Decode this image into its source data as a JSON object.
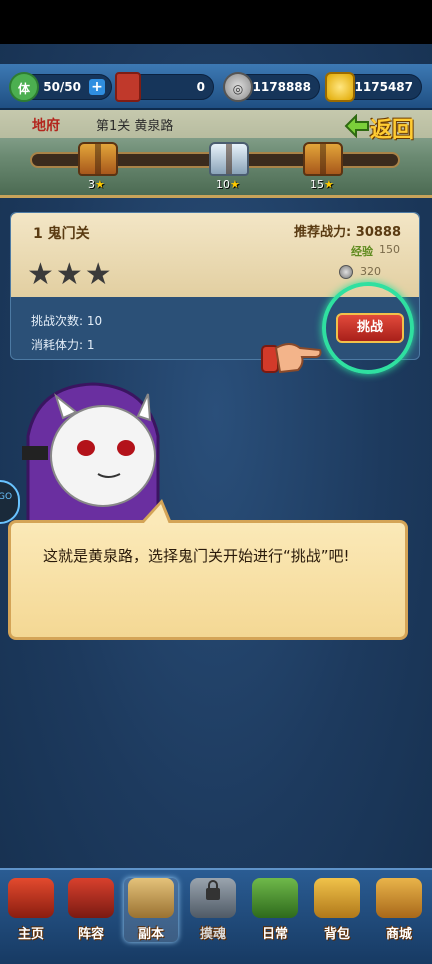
{
  "resources": {
    "stamina": {
      "icon": "stamina-icon",
      "icon_text": "体",
      "value": "50/50",
      "add": "+"
    },
    "tickets": {
      "icon": "ticket-icon",
      "value": "0"
    },
    "silver": {
      "icon": "silver-coin-icon",
      "value": "1178888"
    },
    "gold": {
      "icon": "gold-ingot-icon",
      "value": "1175487"
    }
  },
  "header": {
    "map_name": "地府",
    "stage_title": "第1关 黄泉路",
    "back_label": "返回",
    "chests": [
      {
        "stars": "3",
        "kind": "gold"
      },
      {
        "stars": "10",
        "kind": "silver"
      },
      {
        "stars": "15",
        "kind": "gold"
      }
    ],
    "star_glyph": "★"
  },
  "stage": {
    "name": "1 鬼门关",
    "recommended_power": "推荐战力: 30888",
    "exp_label": "经验",
    "exp_value": "150",
    "coin_value": "320",
    "stars": "★★★",
    "attempts": "挑战次数: 10",
    "stamina_cost": "消耗体力: 1",
    "challenge_button": "挑战"
  },
  "dialog": {
    "text": "这就是黄泉路，选择鬼门关开始进行“挑战”吧!"
  },
  "nav": [
    {
      "label": "主页",
      "icon": "home-icon"
    },
    {
      "label": "阵容",
      "icon": "lineup-flag-icon"
    },
    {
      "label": "副本",
      "icon": "dungeon-swords-icon",
      "active": true
    },
    {
      "label": "摸魂",
      "icon": "lock-icon",
      "locked": true
    },
    {
      "label": "日常",
      "icon": "daily-scroll-icon"
    },
    {
      "label": "背包",
      "icon": "bag-icon"
    },
    {
      "label": "商城",
      "icon": "shop-icon"
    }
  ],
  "colors": {
    "accent_red": "#b3261e",
    "challenge_ring": "#2fe0a0",
    "gold_text": "#ffcc33"
  }
}
